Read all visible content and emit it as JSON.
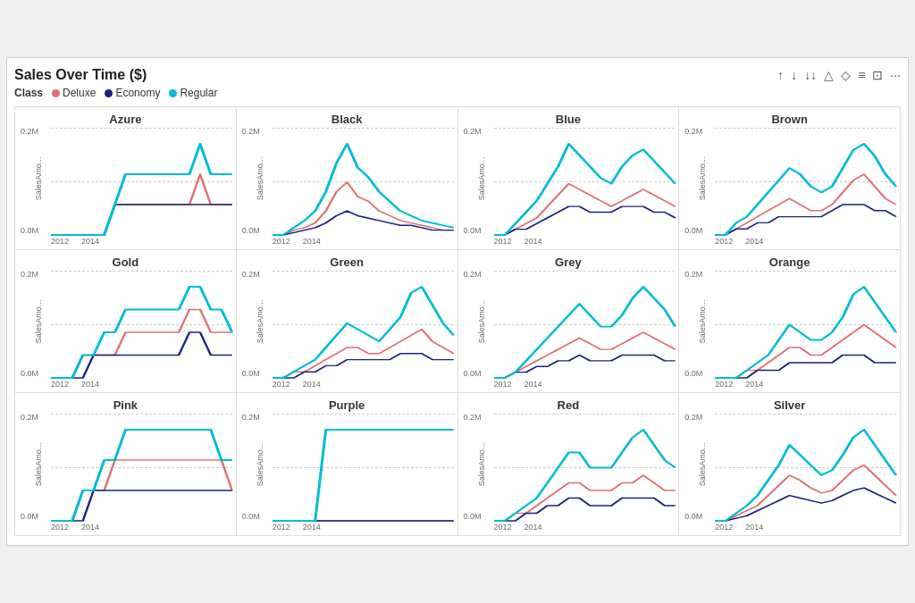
{
  "title": "Sales Over Time ($)",
  "legend": {
    "class_label": "Class",
    "items": [
      {
        "name": "Deluxe",
        "color": "#e07070"
      },
      {
        "name": "Economy",
        "color": "#1a237e"
      },
      {
        "name": "Regular",
        "color": "#00bcd4"
      }
    ]
  },
  "toolbar": {
    "icons": [
      "↑",
      "↓",
      "↓↓",
      "△",
      "◇",
      "≡",
      "⊡",
      "···"
    ]
  },
  "y_axis_label": "SalesAmo...",
  "x_ticks": [
    "2012",
    "2014"
  ],
  "cells": [
    {
      "name": "Azure",
      "series": {
        "deluxe": [
          0,
          0,
          0,
          0,
          0,
          0,
          1,
          1,
          1,
          1,
          1,
          1,
          1,
          1,
          2,
          1,
          1,
          1
        ],
        "economy": [
          0,
          0,
          0,
          0,
          0,
          0,
          1,
          1,
          1,
          1,
          1,
          1,
          1,
          1,
          1,
          1,
          1,
          1
        ],
        "regular": [
          0,
          0,
          0,
          0,
          0,
          0,
          1,
          2,
          2,
          2,
          2,
          2,
          2,
          2,
          3,
          2,
          2,
          2
        ]
      }
    },
    {
      "name": "Black",
      "series": {
        "deluxe": [
          0,
          0,
          2,
          3,
          5,
          10,
          18,
          22,
          16,
          14,
          10,
          8,
          6,
          5,
          4,
          3,
          2,
          2
        ],
        "economy": [
          0,
          0,
          1,
          2,
          3,
          5,
          8,
          10,
          8,
          7,
          6,
          5,
          4,
          4,
          3,
          2,
          2,
          2
        ],
        "regular": [
          0,
          0,
          3,
          6,
          10,
          18,
          30,
          38,
          28,
          24,
          18,
          14,
          10,
          8,
          6,
          5,
          4,
          3
        ]
      }
    },
    {
      "name": "Blue",
      "series": {
        "deluxe": [
          0,
          0,
          1,
          2,
          3,
          5,
          7,
          9,
          8,
          7,
          6,
          5,
          6,
          7,
          8,
          7,
          6,
          5
        ],
        "economy": [
          0,
          0,
          1,
          1,
          2,
          3,
          4,
          5,
          5,
          4,
          4,
          4,
          5,
          5,
          5,
          4,
          4,
          3
        ],
        "regular": [
          0,
          0,
          2,
          4,
          6,
          9,
          12,
          16,
          14,
          12,
          10,
          9,
          12,
          14,
          15,
          13,
          11,
          9
        ]
      }
    },
    {
      "name": "Brown",
      "series": {
        "deluxe": [
          0,
          0,
          1,
          2,
          3,
          4,
          5,
          6,
          5,
          4,
          4,
          5,
          7,
          9,
          10,
          8,
          6,
          5
        ],
        "economy": [
          0,
          0,
          1,
          1,
          2,
          2,
          3,
          3,
          3,
          3,
          3,
          4,
          5,
          5,
          5,
          4,
          4,
          3
        ],
        "regular": [
          0,
          0,
          2,
          3,
          5,
          7,
          9,
          11,
          10,
          8,
          7,
          8,
          11,
          14,
          15,
          13,
          10,
          8
        ]
      }
    },
    {
      "name": "Gold",
      "series": {
        "deluxe": [
          0,
          0,
          0,
          1,
          1,
          1,
          1,
          2,
          2,
          2,
          2,
          2,
          2,
          3,
          3,
          2,
          2,
          2
        ],
        "economy": [
          0,
          0,
          0,
          0,
          1,
          1,
          1,
          1,
          1,
          1,
          1,
          1,
          1,
          2,
          2,
          1,
          1,
          1
        ],
        "regular": [
          0,
          0,
          0,
          1,
          1,
          2,
          2,
          3,
          3,
          3,
          3,
          3,
          3,
          4,
          4,
          3,
          3,
          2
        ]
      }
    },
    {
      "name": "Green",
      "series": {
        "deluxe": [
          0,
          0,
          1,
          1,
          2,
          3,
          4,
          5,
          5,
          4,
          4,
          5,
          6,
          7,
          8,
          6,
          5,
          4
        ],
        "economy": [
          0,
          0,
          0,
          1,
          1,
          2,
          2,
          3,
          3,
          3,
          3,
          3,
          4,
          4,
          4,
          3,
          3,
          3
        ],
        "regular": [
          0,
          0,
          1,
          2,
          3,
          5,
          7,
          9,
          8,
          7,
          6,
          8,
          10,
          14,
          15,
          12,
          9,
          7
        ]
      }
    },
    {
      "name": "Grey",
      "series": {
        "deluxe": [
          0,
          0,
          1,
          2,
          3,
          4,
          5,
          6,
          7,
          6,
          5,
          5,
          6,
          7,
          8,
          7,
          6,
          5
        ],
        "economy": [
          0,
          0,
          1,
          1,
          2,
          2,
          3,
          3,
          4,
          3,
          3,
          3,
          4,
          4,
          4,
          4,
          3,
          3
        ],
        "regular": [
          0,
          0,
          1,
          3,
          5,
          7,
          9,
          11,
          13,
          11,
          9,
          9,
          11,
          14,
          16,
          14,
          12,
          9
        ]
      }
    },
    {
      "name": "Orange",
      "series": {
        "deluxe": [
          0,
          0,
          0,
          1,
          1,
          2,
          3,
          4,
          4,
          3,
          3,
          4,
          5,
          6,
          7,
          6,
          5,
          4
        ],
        "economy": [
          0,
          0,
          0,
          0,
          1,
          1,
          1,
          2,
          2,
          2,
          2,
          2,
          3,
          3,
          3,
          2,
          2,
          2
        ],
        "regular": [
          0,
          0,
          0,
          1,
          2,
          3,
          5,
          7,
          6,
          5,
          5,
          6,
          8,
          11,
          12,
          10,
          8,
          6
        ]
      }
    },
    {
      "name": "Pink",
      "series": {
        "deluxe": [
          0,
          0,
          0,
          1,
          1,
          1,
          2,
          2,
          2,
          2,
          2,
          2,
          2,
          2,
          2,
          2,
          2,
          1
        ],
        "economy": [
          0,
          0,
          0,
          0,
          1,
          1,
          1,
          1,
          1,
          1,
          1,
          1,
          1,
          1,
          1,
          1,
          1,
          1
        ],
        "regular": [
          0,
          0,
          0,
          1,
          1,
          2,
          2,
          3,
          3,
          3,
          3,
          3,
          3,
          3,
          3,
          3,
          2,
          2
        ]
      }
    },
    {
      "name": "Purple",
      "series": {
        "deluxe": [
          0,
          0,
          0,
          0,
          0,
          0,
          0,
          0,
          0,
          0,
          0,
          0,
          0,
          0,
          0,
          0,
          0,
          0
        ],
        "economy": [
          0,
          0,
          0,
          0,
          0,
          0,
          0,
          0,
          0,
          0,
          0,
          0,
          0,
          0,
          0,
          0,
          0,
          0
        ],
        "regular": [
          0,
          0,
          0,
          0,
          0,
          1,
          1,
          1,
          1,
          1,
          1,
          1,
          1,
          1,
          1,
          1,
          1,
          1
        ]
      }
    },
    {
      "name": "Red",
      "series": {
        "deluxe": [
          0,
          0,
          1,
          1,
          2,
          3,
          4,
          5,
          5,
          4,
          4,
          4,
          5,
          5,
          6,
          5,
          4,
          4
        ],
        "economy": [
          0,
          0,
          0,
          1,
          1,
          2,
          2,
          3,
          3,
          2,
          2,
          2,
          3,
          3,
          3,
          3,
          2,
          2
        ],
        "regular": [
          0,
          0,
          1,
          2,
          3,
          5,
          7,
          9,
          9,
          7,
          7,
          7,
          9,
          11,
          12,
          10,
          8,
          7
        ]
      }
    },
    {
      "name": "Silver",
      "series": {
        "deluxe": [
          0,
          0,
          2,
          4,
          6,
          10,
          14,
          18,
          16,
          13,
          11,
          12,
          16,
          20,
          22,
          18,
          14,
          10
        ],
        "economy": [
          0,
          0,
          1,
          2,
          4,
          6,
          8,
          10,
          9,
          8,
          7,
          8,
          10,
          12,
          13,
          11,
          9,
          7
        ],
        "regular": [
          0,
          0,
          3,
          6,
          10,
          16,
          22,
          30,
          26,
          22,
          18,
          20,
          26,
          33,
          36,
          30,
          24,
          18
        ]
      }
    }
  ],
  "colors": {
    "deluxe": "#e07070",
    "economy": "#1a237e",
    "regular": "#00bcd4"
  }
}
